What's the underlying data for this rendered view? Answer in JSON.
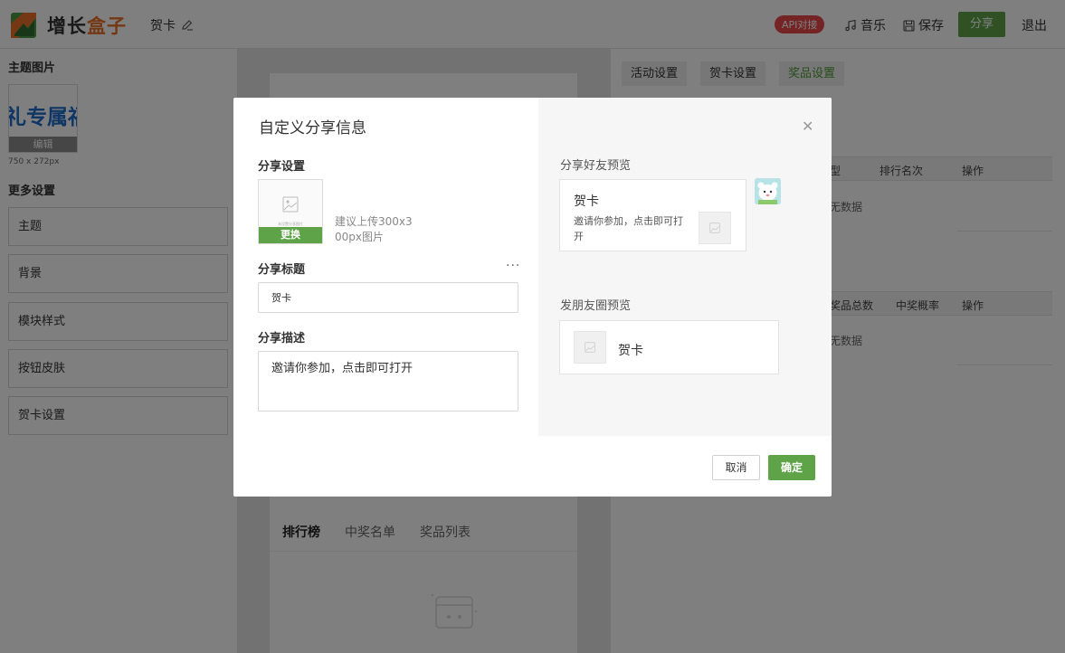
{
  "header": {
    "logo_text_a": "增长",
    "logo_text_b": "盒子",
    "page_name": "贺卡",
    "api_badge": "API对接",
    "music_label": "音乐",
    "save_label": "保存",
    "share_label": "分享",
    "exit_label": "退出"
  },
  "sidebar": {
    "theme_image_title": "主题图片",
    "theme_image_text": "礼专属福",
    "edit_label": "编辑",
    "image_size": "750 x 272px",
    "more_settings_title": "更多设置",
    "items": [
      {
        "label": "主题"
      },
      {
        "label": "背景"
      },
      {
        "label": "模块样式"
      },
      {
        "label": "按钮皮肤"
      },
      {
        "label": "贺卡设置"
      }
    ]
  },
  "preview": {
    "tabs": [
      {
        "label": "排行榜"
      },
      {
        "label": "中奖名单"
      },
      {
        "label": "奖品列表"
      }
    ]
  },
  "settings": {
    "tabs": [
      {
        "label": "活动设置"
      },
      {
        "label": "贺卡设置"
      },
      {
        "label": "奖品设置"
      }
    ],
    "table1_headers": [
      "型",
      "排行名次",
      "操作"
    ],
    "table2_headers": [
      "奖品总数",
      "中奖概率",
      "操作"
    ],
    "no_data": "无数据"
  },
  "modal": {
    "title": "自定义分享信息",
    "share_settings_label": "分享设置",
    "upload_tiny_text": "未设置分享图片",
    "replace_label": "更换",
    "upload_hint": "建议上传300x300px图片",
    "share_title_label": "分享标题",
    "share_title_value": "贺卡",
    "share_desc_label": "分享描述",
    "share_desc_value": "邀请你参加，点击即可打开",
    "friend_preview_label": "分享好友预览",
    "friend_card_title": "贺卡",
    "friend_card_desc": "邀请你参加，点击即可打开",
    "moments_preview_label": "发朋友圈预览",
    "moments_card_title": "贺卡",
    "cancel_label": "取消",
    "confirm_label": "确定"
  },
  "colors": {
    "brand_green": "#5fa349",
    "brand_orange": "#e8702a",
    "api_red": "#e9484b",
    "active_tab_green": "#4e9b35"
  }
}
